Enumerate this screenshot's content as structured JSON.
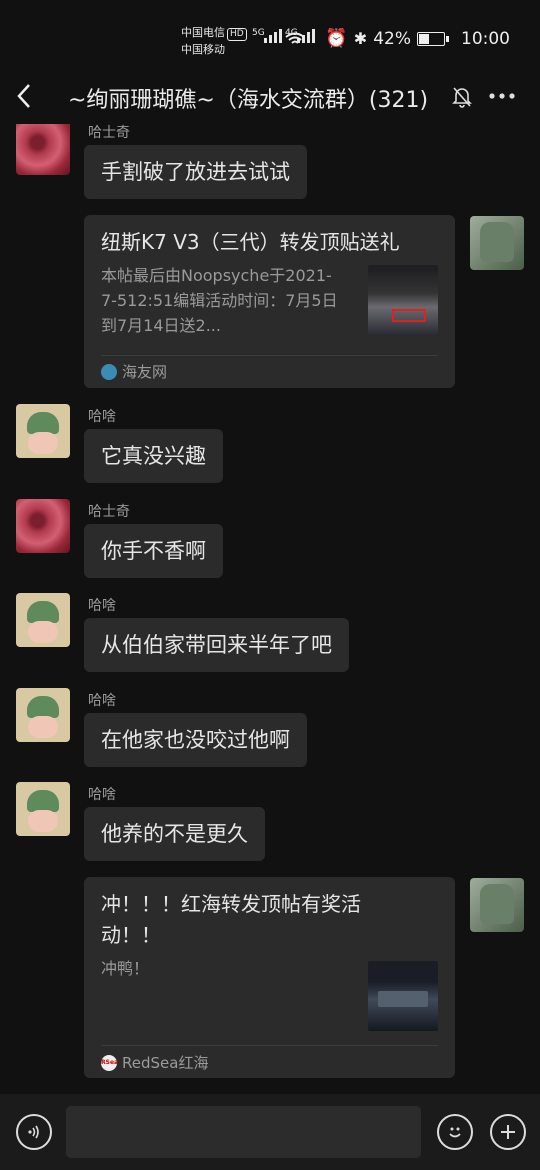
{
  "status": {
    "carrier1": "中国电信",
    "hd": "HD",
    "carrier2": "中国移动",
    "net1": "5G",
    "net2": "4G",
    "battery_text": "42%",
    "battery_level": 0.42,
    "time": "10:00"
  },
  "header": {
    "back_icon": "chevron-left-icon",
    "title": "~绚丽珊瑚礁~（海水交流群）(321)",
    "mute_icon": "bell-off-icon",
    "more_icon": "more-icon"
  },
  "messages": [
    {
      "sender": "哈士奇",
      "text": "手割破了放进去试试"
    },
    {
      "card_title": "纽斯K7 V3（三代）转发顶贴送礼",
      "card_desc": "本帖最后由Noopsyche于2021-7-512:51编辑活动时间：7月5日到7月14日送2...",
      "card_source": "海友网"
    },
    {
      "sender": "哈啥",
      "text": "它真没兴趣"
    },
    {
      "sender": "哈士奇",
      "text": "你手不香啊"
    },
    {
      "sender": "哈啥",
      "text": "从伯伯家带回来半年了吧"
    },
    {
      "sender": "哈啥",
      "text": "在他家也没咬过他啊"
    },
    {
      "sender": "哈啥",
      "text": "他养的不是更久"
    },
    {
      "card_title": "冲！！！红海转发顶帖有奖活动！！",
      "card_desc": "冲鸭！",
      "card_source": "RedSea红海",
      "source_logo": "RSea"
    }
  ],
  "input": {
    "voice_icon": "voice-icon",
    "emoji_icon": "emoji-icon",
    "plus_icon": "plus-icon"
  }
}
